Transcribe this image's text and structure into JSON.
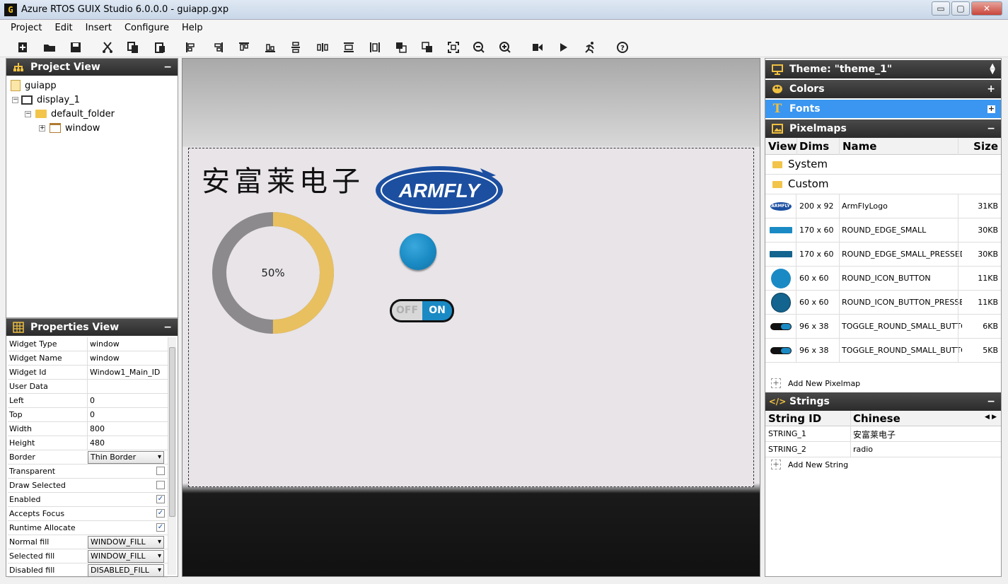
{
  "window": {
    "title": "Azure RTOS GUIX Studio 6.0.0.0 - guiapp.gxp",
    "app_icon": "G",
    "min": "▭",
    "max": "▢",
    "close": "✕"
  },
  "menu": [
    "Project",
    "Edit",
    "Insert",
    "Configure",
    "Help"
  ],
  "toolbar_icons": [
    "new-file-icon",
    "open-folder-icon",
    "save-icon",
    "cut-icon",
    "copy-icon",
    "paste-icon",
    "align-left-icon",
    "align-right-icon",
    "align-top-icon",
    "align-bottom-icon",
    "v-equal-spacing-icon",
    "h-equal-spacing-icon",
    "equal-width-icon",
    "equal-height-icon",
    "move-to-front-icon",
    "move-to-back-icon",
    "size-to-fit-icon",
    "zoom-out-icon",
    "zoom-in-icon",
    "record-macro-icon",
    "run-icon",
    "playback-icon",
    "help-icon"
  ],
  "project_view": {
    "title": "Project View",
    "collapse": "−",
    "tree": [
      {
        "label": "guiapp",
        "icon": "project-file-icon",
        "indent": 0
      },
      {
        "label": "display_1",
        "icon": "display-icon",
        "indent": 1
      },
      {
        "label": "default_folder",
        "icon": "folder-icon",
        "indent": 2
      },
      {
        "label": "window",
        "icon": "window-icon",
        "indent": 3
      }
    ]
  },
  "properties_view": {
    "title": "Properties View",
    "collapse": "−",
    "rows": [
      {
        "label": "Widget Type",
        "value": "window",
        "kind": "text"
      },
      {
        "label": "Widget Name",
        "value": "window",
        "kind": "text"
      },
      {
        "label": "Widget Id",
        "value": "Window1_Main_ID",
        "kind": "text"
      },
      {
        "label": "User Data",
        "value": "",
        "kind": "text"
      },
      {
        "label": "Left",
        "value": "0",
        "kind": "text"
      },
      {
        "label": "Top",
        "value": "0",
        "kind": "text"
      },
      {
        "label": "Width",
        "value": "800",
        "kind": "text"
      },
      {
        "label": "Height",
        "value": "480",
        "kind": "text"
      },
      {
        "label": "Border",
        "value": "Thin Border",
        "kind": "select"
      },
      {
        "label": "Transparent",
        "value": "",
        "kind": "check",
        "checked": false
      },
      {
        "label": "Draw Selected",
        "value": "",
        "kind": "check",
        "checked": false
      },
      {
        "label": "Enabled",
        "value": "",
        "kind": "check",
        "checked": true
      },
      {
        "label": "Accepts Focus",
        "value": "",
        "kind": "check",
        "checked": true
      },
      {
        "label": "Runtime Allocate",
        "value": "",
        "kind": "check",
        "checked": true
      },
      {
        "label": "Normal fill",
        "value": "WINDOW_FILL",
        "kind": "select"
      },
      {
        "label": "Selected fill",
        "value": "WINDOW_FILL",
        "kind": "select"
      },
      {
        "label": "Disabled fill",
        "value": "DISABLED_FILL",
        "kind": "select"
      }
    ]
  },
  "canvas": {
    "chinese_title": "安富莱电子",
    "logo_text": "ARMFLY",
    "progress_text": "50%",
    "progress_value": 0.5,
    "toggle_off": "OFF",
    "toggle_on": "ON"
  },
  "right_panel": {
    "theme": "Theme: \"theme_1\"",
    "colors": "Colors",
    "colors_btn": "+",
    "fonts": "Fonts",
    "fonts_btn": "+",
    "pixelmaps": "Pixelmaps",
    "pixelmaps_btn": "−",
    "pix_headers": [
      "View",
      "Dims",
      "Name",
      "Size"
    ],
    "folders": [
      "System",
      "Custom"
    ],
    "pixelmap_rows": [
      {
        "dims": "200 x 92",
        "name": "ArmFlyLogo",
        "size": "31KB",
        "thumb": "logo"
      },
      {
        "dims": "170 x 60",
        "name": "ROUND_EDGE_SMALL",
        "size": "30KB",
        "thumb": "bar"
      },
      {
        "dims": "170 x 60",
        "name": "ROUND_EDGE_SMALL_PRESSED",
        "size": "30KB",
        "thumb": "bar-dark"
      },
      {
        "dims": "60 x 60",
        "name": "ROUND_ICON_BUTTON",
        "size": "11KB",
        "thumb": "circle"
      },
      {
        "dims": "60 x 60",
        "name": "ROUND_ICON_BUTTON_PRESSED",
        "size": "11KB",
        "thumb": "circle-dark"
      },
      {
        "dims": "96 x 38",
        "name": "TOGGLE_ROUND_SMALL_BUTTON",
        "size": "6KB",
        "thumb": "toggle"
      },
      {
        "dims": "96 x 38",
        "name": "TOGGLE_ROUND_SMALL_BUTTON_OFF",
        "size": "5KB",
        "thumb": "toggle"
      }
    ],
    "add_pixelmap": "Add New Pixelmap",
    "strings": "Strings",
    "strings_btn": "−",
    "string_headers": [
      "String ID",
      "Chinese"
    ],
    "string_rows": [
      {
        "id": "STRING_1",
        "value": "安富莱电子"
      },
      {
        "id": "STRING_2",
        "value": "radio"
      }
    ],
    "add_string": "Add New String"
  },
  "colors": {
    "accent_blue": "#3a96f0",
    "panel_dark": "#2b2b2b",
    "progress_gold": "#e8c060",
    "progress_gray": "#8c8a8c",
    "button_blue": "#1a8ac4"
  }
}
